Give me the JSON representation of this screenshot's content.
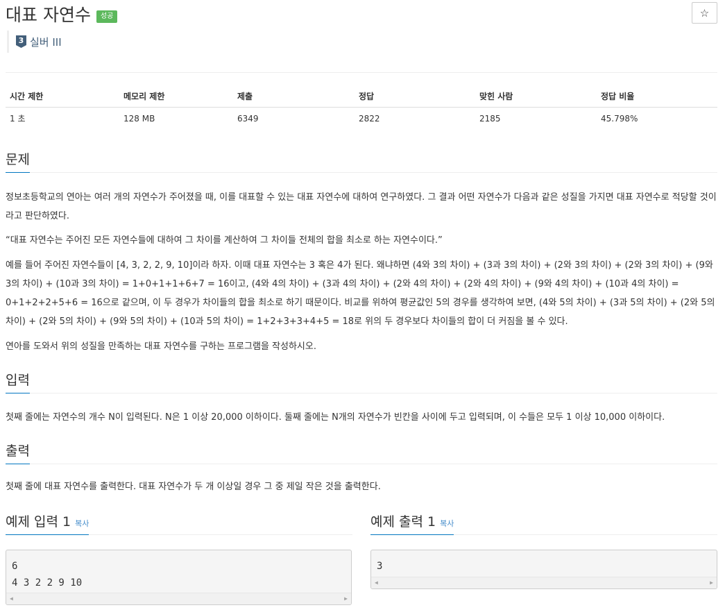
{
  "problem": {
    "title": "대표 자연수",
    "status_badge": "성공",
    "star_icon": "☆",
    "tier": {
      "icon_text": "3",
      "label": "실버 III"
    }
  },
  "info_table": {
    "headers": [
      "시간 제한",
      "메모리 제한",
      "제출",
      "정답",
      "맞힌 사람",
      "정답 비율"
    ],
    "values": [
      "1 초",
      "128 MB",
      "6349",
      "2822",
      "2185",
      "45.798%"
    ]
  },
  "sections": {
    "problem": {
      "heading": "문제",
      "paragraphs": [
        "정보초등학교의 연아는 여러 개의 자연수가 주어졌을 때, 이를 대표할 수 있는 대표 자연수에 대하여 연구하였다. 그 결과 어떤 자연수가 다음과 같은 성질을 가지면 대표 자연수로 적당할 것이라고 판단하였다.",
        "“대표 자연수는 주어진 모든 자연수들에 대하여 그 차이를 계산하여 그 차이들 전체의 합을 최소로 하는 자연수이다.”",
        "예를 들어 주어진 자연수들이 [4, 3, 2, 2, 9, 10]이라 하자. 이때 대표 자연수는 3 혹은 4가 된다. 왜냐하면 (4와 3의 차이) + (3과 3의 차이) + (2와 3의 차이) + (2와 3의 차이) + (9와 3의 차이) + (10과 3의 차이) = 1+0+1+1+6+7 = 16이고, (4와 4의 차이) + (3과 4의 차이) + (2와 4의 차이) + (2와 4의 차이) + (9와 4의 차이) + (10과 4의 차이) = 0+1+2+2+5+6 = 16으로 같으며, 이 두 경우가 차이들의 합을 최소로 하기 때문이다. 비교를 위하여 평균값인 5의 경우를 생각하여 보면, (4와 5의 차이) + (3과 5의 차이) + (2와 5의 차이) + (2와 5의 차이) + (9와 5의 차이) + (10과 5의 차이) = 1+2+3+3+4+5 = 18로 위의 두 경우보다 차이들의 합이 더 커짐을 볼 수 있다.",
        "연아를 도와서 위의 성질을 만족하는 대표 자연수를 구하는 프로그램을 작성하시오."
      ]
    },
    "input": {
      "heading": "입력",
      "text": "첫째 줄에는 자연수의 개수 N이 입력된다. N은 1 이상 20,000 이하이다. 둘째 줄에는 N개의 자연수가 빈칸을 사이에 두고 입력되며, 이 수들은 모두 1 이상 10,000 이하이다."
    },
    "output": {
      "heading": "출력",
      "text": "첫째 줄에 대표 자연수를 출력한다. 대표 자연수가 두 개 이상일 경우 그 중 제일 작은 것을 출력한다."
    }
  },
  "samples": {
    "input": {
      "heading": "예제 입력 1",
      "copy_label": "복사",
      "content": "6\n4 3 2 2 9 10"
    },
    "output": {
      "heading": "예제 출력 1",
      "copy_label": "복사",
      "content": "3"
    }
  },
  "colors": {
    "success": "#5cb85c",
    "accent_line": "#0076c0",
    "tier": "#435f7a",
    "link": "#428bca"
  }
}
